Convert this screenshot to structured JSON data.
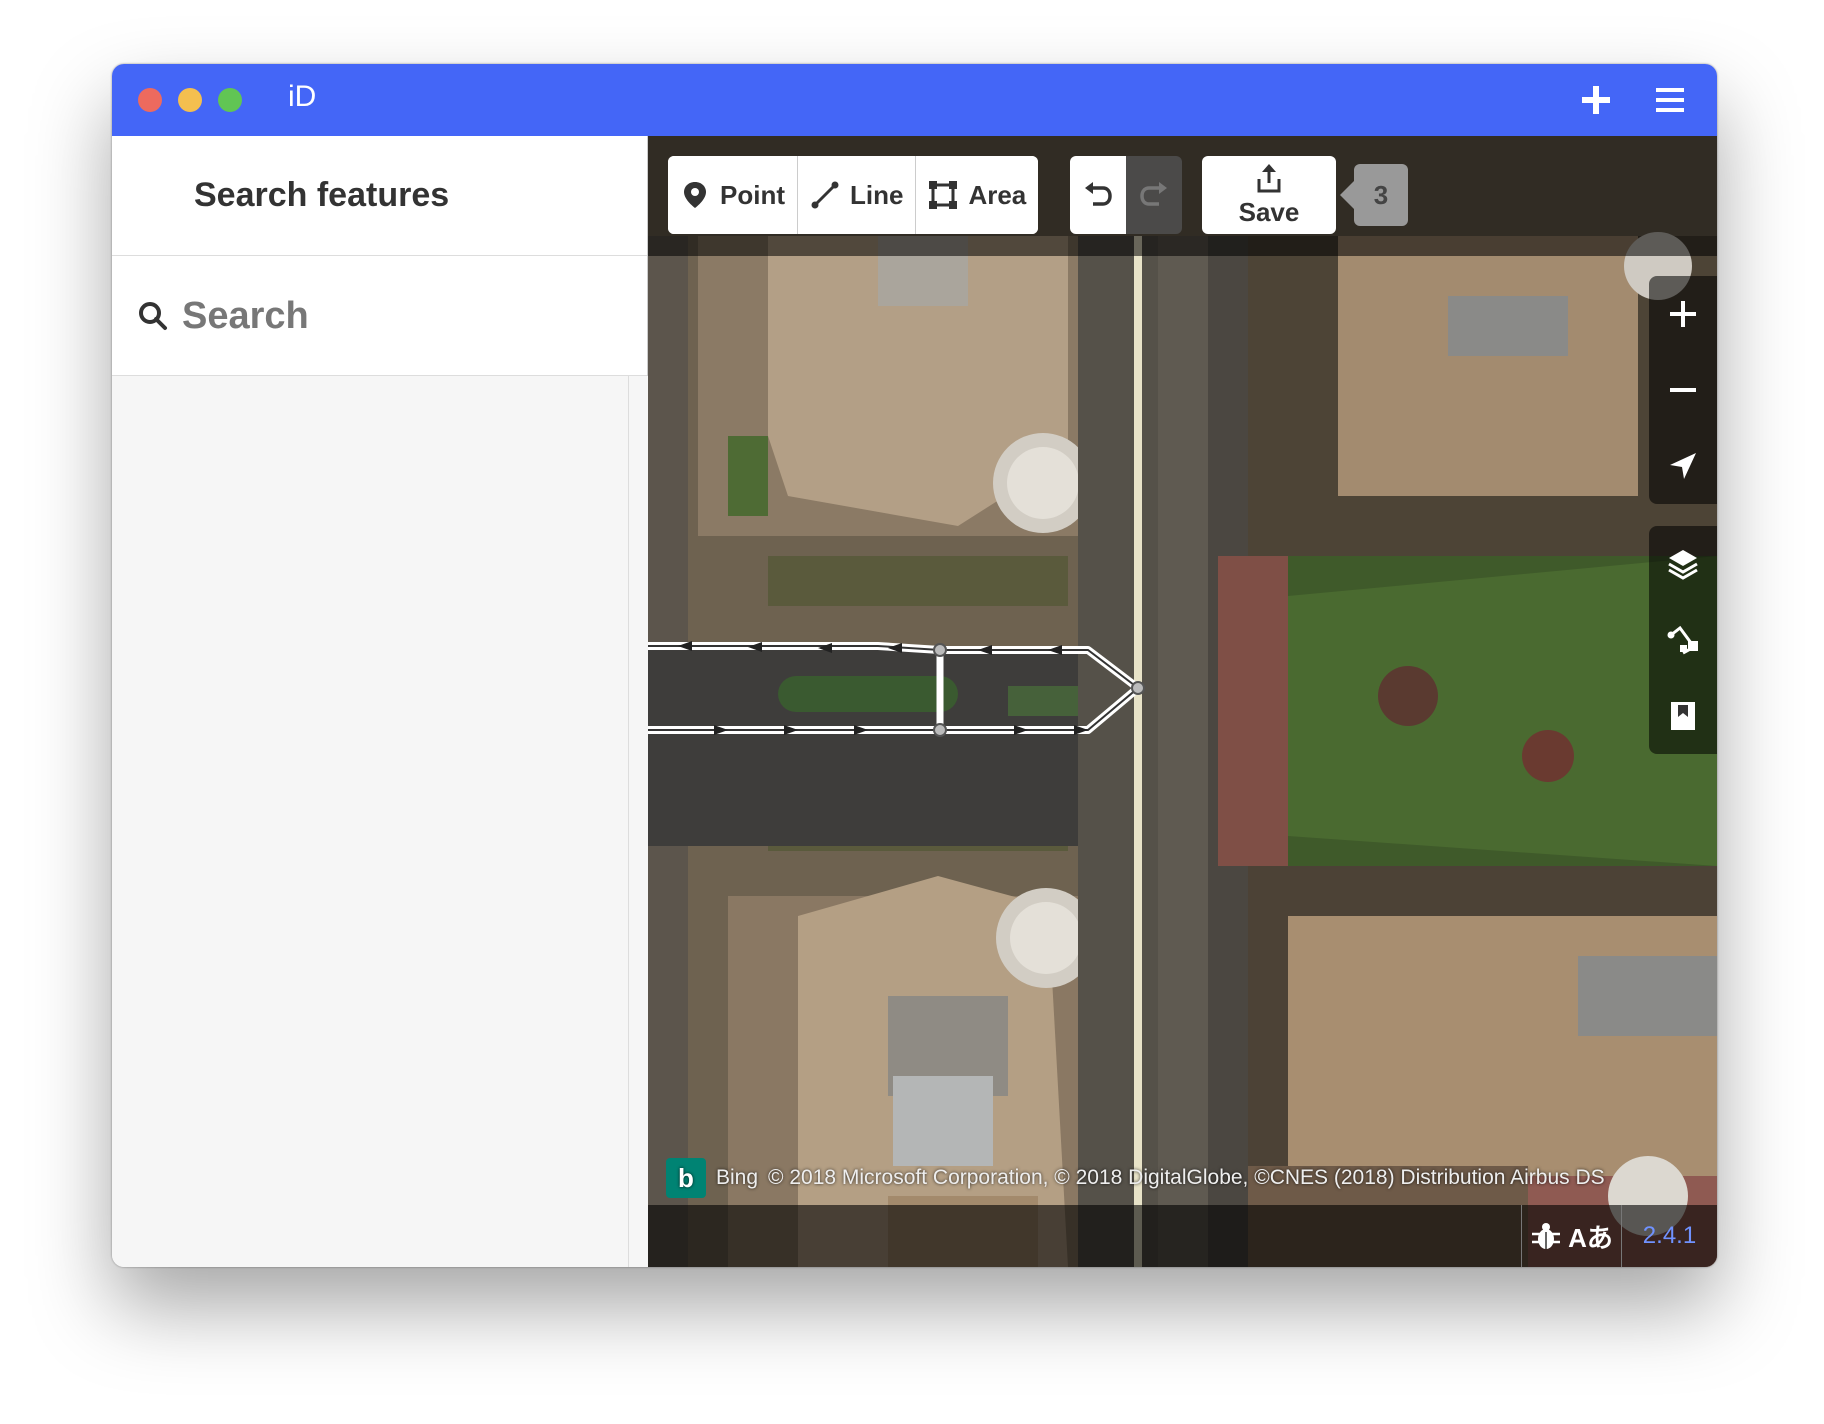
{
  "window": {
    "title": "iD",
    "controls": [
      "close-icon",
      "minimize-icon",
      "zoom-icon"
    ],
    "actions": [
      "plus-icon",
      "menu-icon"
    ]
  },
  "sidebar": {
    "title": "Search features",
    "search": {
      "placeholder": "Search",
      "value": ""
    }
  },
  "toolbar": {
    "modes": [
      {
        "label": "Point",
        "icon": "point-icon"
      },
      {
        "label": "Line",
        "icon": "line-icon"
      },
      {
        "label": "Area",
        "icon": "area-icon"
      }
    ],
    "undo_icon": "undo-icon",
    "redo_icon": "redo-icon",
    "save_label": "Save",
    "save_icon": "upload-icon",
    "edit_count": "3"
  },
  "map_controls": [
    "zoom-in-icon",
    "zoom-out-icon",
    "geolocate-icon",
    "layers-icon",
    "map-data-icon",
    "help-icon"
  ],
  "attribution": {
    "provider": "Bing",
    "text": "© 2018 Microsoft Corporation, © 2018 DigitalGlobe, ©CNES (2018) Distribution Airbus DS"
  },
  "footer": {
    "issues_icon": "bug-icon",
    "language_icon": "translate-icon",
    "language_text": "Aあ",
    "version": "2.4.1"
  },
  "colors": {
    "titlebar": "#4466f7",
    "bing": "#008373",
    "version": "#7092ff"
  }
}
